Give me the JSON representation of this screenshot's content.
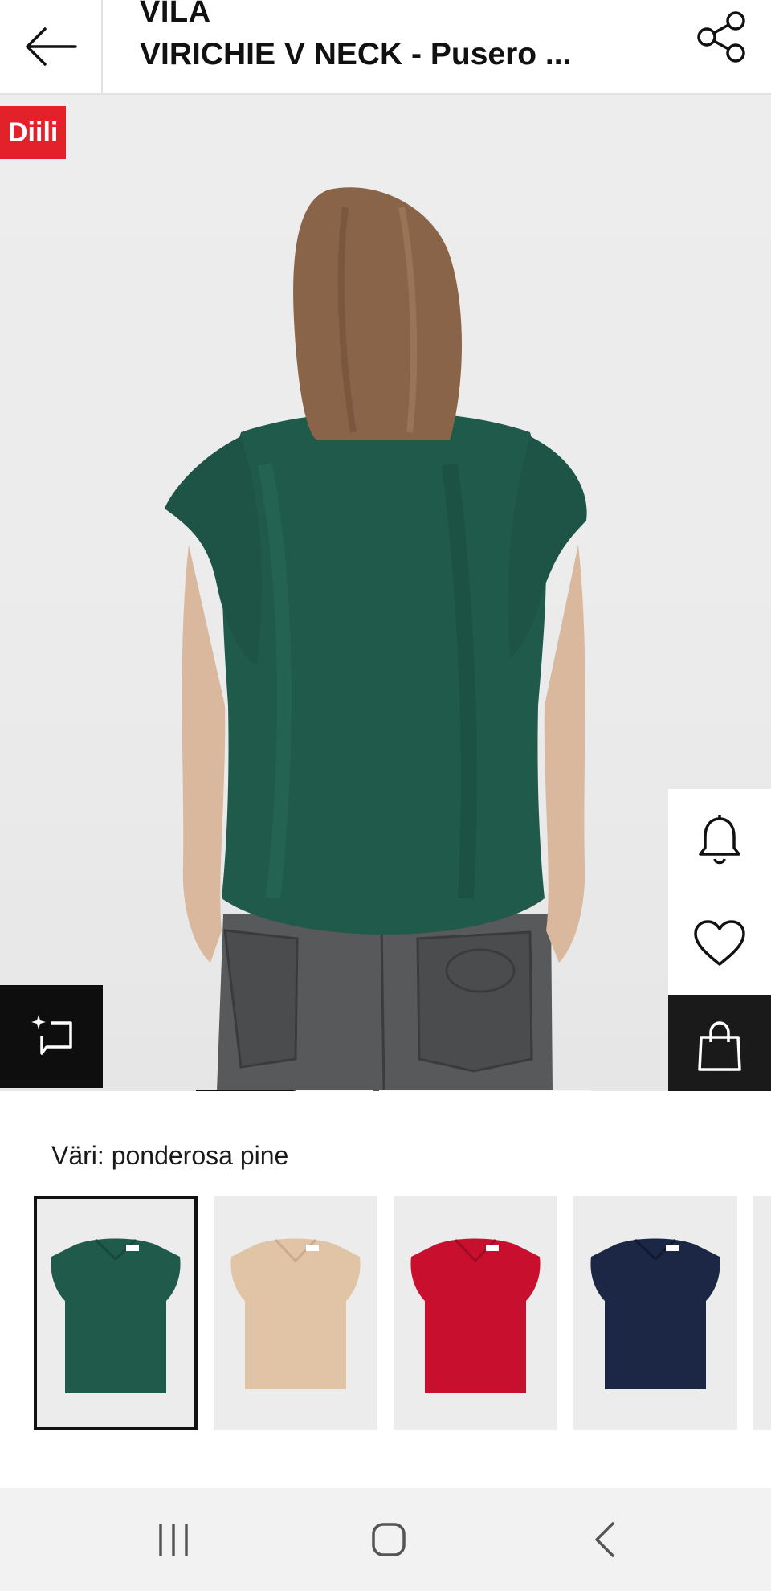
{
  "header": {
    "brand": "VILA",
    "product_title": "VIRICHIE V NECK - Pusero ...",
    "back_icon": "arrow-left-icon",
    "share_icon": "share-icon"
  },
  "hero": {
    "deal_badge": "Diili",
    "deal_color": "#e3212b",
    "product_color": "#1f5a4a",
    "gallery_current_image": 1,
    "gallery_image_count": 4
  },
  "side_actions": [
    {
      "name": "notify",
      "icon": "bell-icon"
    },
    {
      "name": "wishlist",
      "icon": "heart-icon"
    },
    {
      "name": "add-to-bag",
      "icon": "shopping-bag-icon"
    }
  ],
  "similar_icon": "similar-items-icon",
  "color_selector": {
    "label": "Väri: ponderosa pine",
    "swatches": [
      {
        "name": "ponderosa pine",
        "color": "#1f5a4a",
        "selected": true
      },
      {
        "name": "beige",
        "color": "#e1c4a6",
        "selected": false
      },
      {
        "name": "red",
        "color": "#c8102e",
        "selected": false
      },
      {
        "name": "navy",
        "color": "#1b2745",
        "selected": false
      }
    ]
  },
  "system_nav": {
    "recent_icon": "recent-apps-icon",
    "home_icon": "home-icon",
    "back_icon": "back-chevron-icon"
  }
}
